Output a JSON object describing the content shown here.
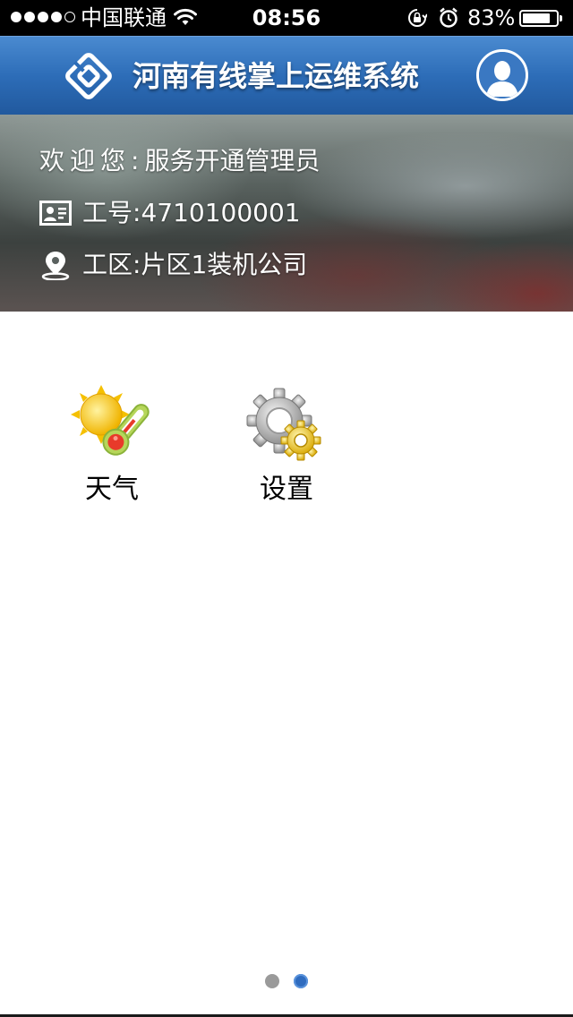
{
  "status_bar": {
    "carrier": "中国联通",
    "time": "08:56",
    "battery_percent": "83%",
    "battery_level": 0.83,
    "signal_bars": 4,
    "signal_total": 5,
    "icons": [
      "wifi-icon",
      "rotation-lock-icon",
      "alarm-icon",
      "battery-icon"
    ]
  },
  "header": {
    "title": "河南有线掌上运维系统",
    "logo_icon": "cable-logo-icon",
    "avatar_icon": "user-avatar-icon",
    "background_color": "#2d6db8"
  },
  "user_info": {
    "welcome_label": "欢迎您:",
    "user_name": "服务开通管理员",
    "employee_id_label": "工号:",
    "employee_id": "4710100001",
    "work_area_label": "工区:",
    "work_area": "片区1装机公司",
    "id_icon": "id-card-icon",
    "area_icon": "location-pin-icon"
  },
  "apps": [
    {
      "label": "天气",
      "icon": "weather-icon"
    },
    {
      "label": "设置",
      "icon": "settings-gear-icon"
    }
  ],
  "pager": {
    "page_count": 2,
    "current_page": 2,
    "active_color": "#2f6cbf",
    "inactive_color": "#9a9a9a"
  }
}
